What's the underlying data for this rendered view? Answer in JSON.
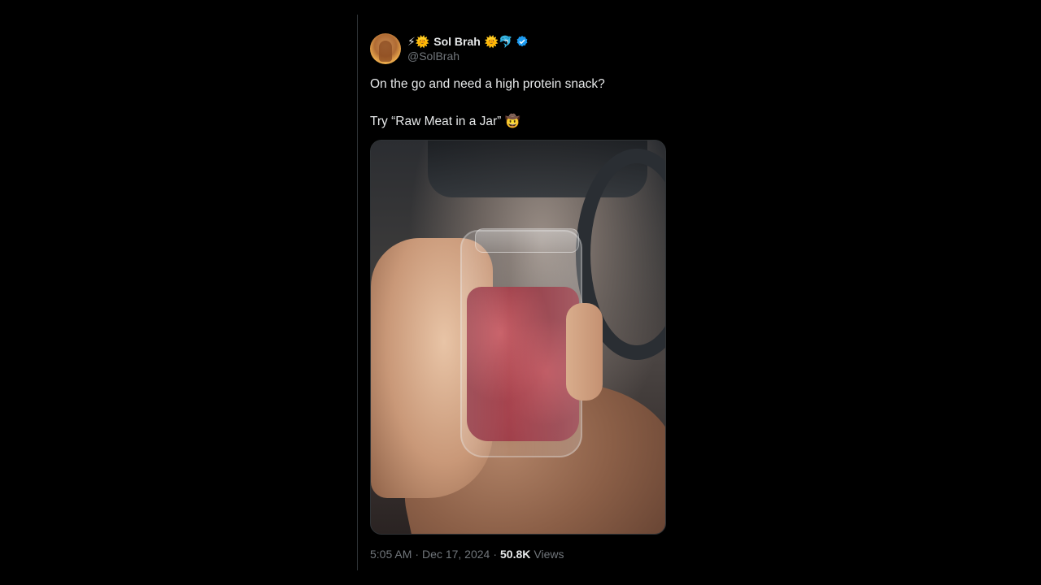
{
  "author": {
    "display_name": "Sol Brah",
    "handle": "@SolBrah",
    "emoji_prefix": "⚡🌞",
    "emoji_suffix": "🌞🐬",
    "verified_color": "#1d9bf0"
  },
  "tweet": {
    "line1": "On the go and need a high protein snack?",
    "line2": "Try “Raw Meat in a Jar” 🤠",
    "media_description_icon": "photo-raw-meat-jar"
  },
  "meta": {
    "time": "5:05 AM",
    "separator": "·",
    "date": "Dec 17, 2024",
    "views_count": "50.8K",
    "views_label": "Views"
  }
}
